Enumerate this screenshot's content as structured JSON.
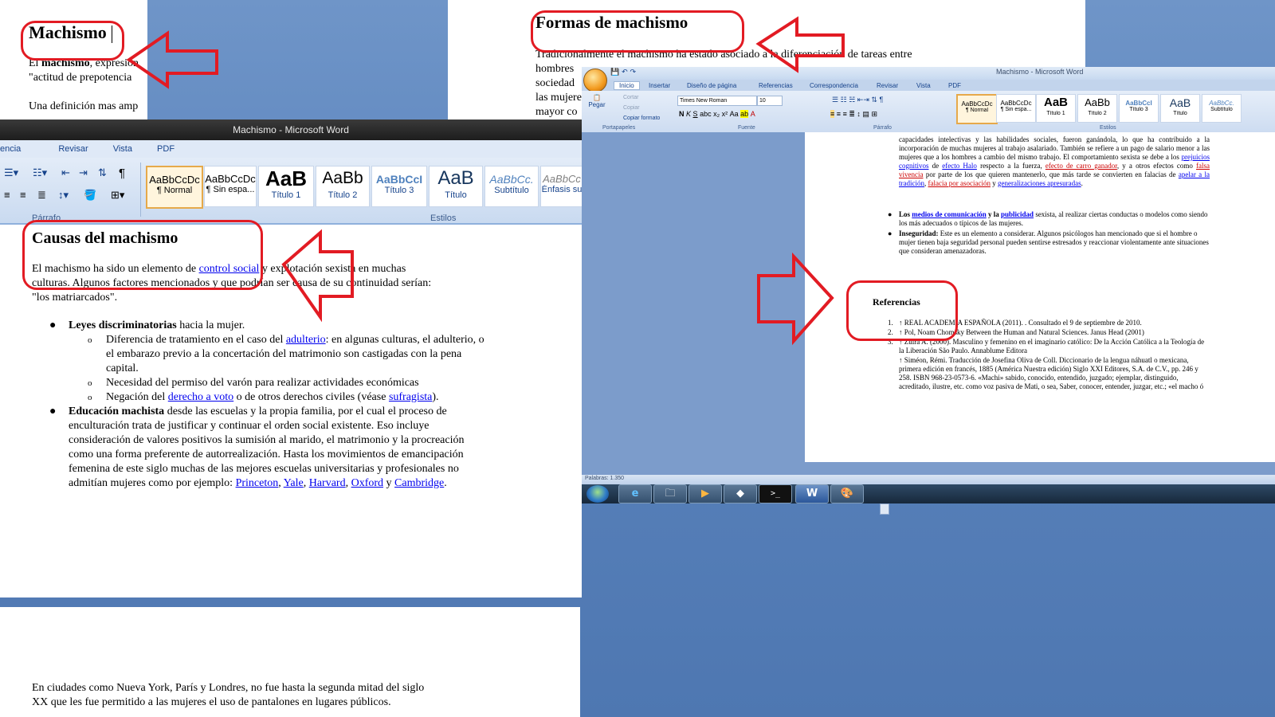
{
  "doc1": {
    "heading": "Machismo",
    "line1_prefix": "El ",
    "line1_bold": "machismo",
    "line1_rest": ", expresión",
    "line2": "\"actitud de prepotencia",
    "line3": "Una definición mas amp"
  },
  "doc2": {
    "heading": "Formas de machismo",
    "lines": [
      "Tradicionalmente el machismo ha estado asociado a la diferenciación de tareas entre",
      "hombres",
      "sociedad",
      "las mujere",
      "mayor co"
    ]
  },
  "window_left": {
    "title": "Machismo - Microsoft Word",
    "tabs": [
      "encia",
      "Revisar",
      "Vista",
      "PDF"
    ],
    "styles": [
      {
        "sample": "AaBbCcDc",
        "name": "¶ Normal"
      },
      {
        "sample": "AaBbCcDc",
        "name": "¶ Sin espa..."
      },
      {
        "sample": "AaB",
        "name": "Título 1"
      },
      {
        "sample": "AaBb",
        "name": "Título 2"
      },
      {
        "sample": "AaBbCcI",
        "name": "Título 3"
      },
      {
        "sample": "AaB",
        "name": "Título"
      },
      {
        "sample": "AaBbCc.",
        "name": "Subtítulo"
      },
      {
        "sample": "AaBbCc",
        "name": "Énfasis su"
      }
    ],
    "group_parrafo": "Párrafo",
    "group_estilos": "Estilos",
    "heading": "Causas del machismo",
    "intro1_a": "El machismo  ha sido un elemento  de ",
    "intro1_link": "control social",
    "intro1_b": " y explotación  sexista  en muchas",
    "intro2": "culturas. Algunos  factores mencionados  y que podrían ser causa  de su continuidad serían:",
    "intro3": "\"los matriarcados\".",
    "b1_bold": "Leyes discriminatorias",
    "b1_rest": "  hacia la mujer.",
    "s1_a": "Diferencia de tratamiento en el caso del ",
    "s1_link": "adulterio",
    "s1_b": ": en algunas culturas, el adulterio, o el embarazo  previo a la concertación  del matrimonio son castigadas con la pena  capital.",
    "s2": "Necesidad del permiso  del varón para realizar  actividades económicas",
    "s3_a": "Negación del ",
    "s3_link": "derecho a voto",
    "s3_b": " o de otros derechos civiles  (véase ",
    "s3_link2": "sufragista",
    "s3_c": ").",
    "b2_bold": "Educación machista",
    "b2_rest": " desde las escuelas y la propia familia, por el cual el proceso de enculturación trata de justificar y continuar el orden social  existente. Eso incluye consideración de valores positivos la sumisión al marido, el matrimonio  y la procreación  como una forma preferente de autorrealización.  Hasta los movimientos de emancipación  femenina de este siglo muchas  de las mejores  escuelas universitarias y profesionales  no admitían mujeres como por ejemplo: ",
    "uni1": "Princeton",
    "uni2": "Yale",
    "uni3": "Harvard",
    "uni4": "Oxford",
    "uni_y": " y ",
    "uni5": "Cambridge",
    "sep1": ", ",
    "sep_dot": "."
  },
  "doc_bottom": {
    "line1": "En ciudades como Nueva York, París y Londres, no fue hasta la segunda mitad del siglo",
    "line2": "XX que les fue permitido a las mujeres el uso de pantalones en lugares públicos."
  },
  "window_right": {
    "title": "Machismo - Microsoft Word",
    "tabs": [
      "Inicio",
      "Insertar",
      "Diseño de página",
      "Referencias",
      "Correspondencia",
      "Revisar",
      "Vista",
      "PDF"
    ],
    "clipboard": {
      "paste": "Pegar",
      "cut": "Cortar",
      "copy": "Copiar",
      "format": "Copiar formato"
    },
    "font_name": "Times New Roman",
    "font_size": "10",
    "groups": [
      "Portapapeles",
      "Fuente",
      "Párrafo",
      "Estilos"
    ],
    "styles": [
      {
        "sample": "AaBbCcDc",
        "name": "¶ Normal"
      },
      {
        "sample": "AaBbCcDc",
        "name": "¶ Sin espa..."
      },
      {
        "sample": "AaB",
        "name": "Título 1"
      },
      {
        "sample": "AaBb",
        "name": "Título 2"
      },
      {
        "sample": "AaBbCcI",
        "name": "Título 3"
      },
      {
        "sample": "AaB",
        "name": "Título"
      },
      {
        "sample": "AaBbCc.",
        "name": "Subtítulo"
      }
    ],
    "p1": "capacidades intelectivas y las habilidades sociales, fueron ganándola, lo que ha contribuido a la incorporación de muchas mujeres al trabajo asalariado. También se refiere a un pago de salario menor a las mujeres que a los hombres a cambio del mismo trabajo. El comportamiento sexista se debe a los ",
    "p1_link1": "prejuicios cognitivos",
    "p1_b": " de ",
    "p1_link2": "efecto Halo",
    "p1_c": " respecto a la fuerza, ",
    "p1_link3": "efecto de carro ganador",
    "p1_d": ", y a otros efectos como ",
    "p1_link4": "falsa vivencia",
    "p1_e": " por parte de los que quieren mantenerlo, que más tarde se convierten en falacias de ",
    "p1_link5": "apelar a la tradición",
    "p1_f": ", ",
    "p1_link6": "falacia por asociación",
    "p1_g": " y ",
    "p1_link7": "generalizaciones apresuradas",
    "p1_h": ".",
    "li1_a": "Los ",
    "li1_link1": "medios de comunicación",
    "li1_b": " y la ",
    "li1_link2": "publicidad",
    "li1_c": " sexista, al realizar ciertas conductas o modelos como siendo los más adecuados o típicos de las mujeres.",
    "li2_bold": "Inseguridad:",
    "li2_rest": " Este es un elemento a considerar. Algunos psicólogos han mencionado que si el hombre o mujer tienen baja seguridad personal pueden sentirse estresados y reaccionar violentamente ante situaciones que consideran amenazadoras.",
    "ref_heading": "Referencias",
    "refs": [
      "↑ REAL ACADEMIA ESPAÑOLA (2011). . Consultado el 9 de septiembre de 2010.",
      "↑ Pol, Noam Chomsky Between the Human and Natural Sciences. Janus Head (2001)",
      "↑ Zuira A. (2000). Masculino y femenino en el imaginario católico: De la Acción Católica a la Teología de la Liberación São Paulo. Annablume Editora",
      "↑ Siméon, Rémi. Traducción de Josefina Oliva de Coll. Diccionario de la lengua náhuatl o mexicana, primera edición en francés, 1885 (América Nuestra edición) Siglo XXI Editores, S.A. de C.V., pp. 246 y 258. ISBN 968-23-0573-6. «Machi» sabido, conocido, entendido, juzgado; ejemplar, distinguido, acreditado, ilustre, etc. como voz pasiva de Mati, o sea, Saber, conocer, entender, juzgar, etc.; «el macho ó"
    ],
    "status": "Palabras: 1.350"
  },
  "taskbar_icons": [
    "start-orb",
    "internet-explorer",
    "file-explorer",
    "media-player",
    "app-generic",
    "command-prompt",
    "word",
    "paint"
  ]
}
